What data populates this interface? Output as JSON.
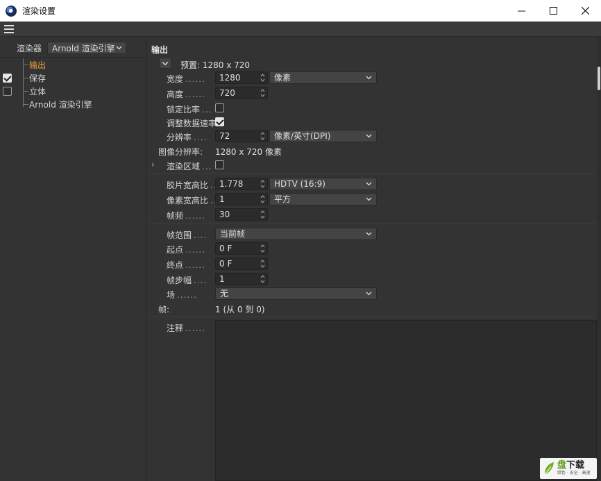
{
  "window": {
    "title": "渲染设置"
  },
  "sidebar": {
    "renderer_label": "渲染器",
    "renderer_value": "Arnold 渲染引擎",
    "items": [
      {
        "label": "输出",
        "active": true,
        "checkbox": false
      },
      {
        "label": "保存",
        "active": false,
        "checkbox": true,
        "checked": true
      },
      {
        "label": "立体",
        "active": false,
        "checkbox": true,
        "checked": false
      },
      {
        "label": "Arnold 渲染引擎",
        "active": false,
        "checkbox": false
      }
    ]
  },
  "output": {
    "section_title": "输出",
    "preset": "预置: 1280 x 720",
    "width_label": "宽度",
    "width_value": "1280",
    "height_label": "高度",
    "height_value": "720",
    "unit_value": "像素",
    "lock_ratio_label": "锁定比率",
    "lock_ratio_checked": false,
    "adjust_rate_label": "调整数据速率",
    "adjust_rate_checked": true,
    "resolution_label": "分辨率",
    "resolution_value": "72",
    "resolution_unit": "像素/英寸(DPI)",
    "image_resolution_label": "图像分辨率:",
    "image_resolution_value": "1280 x 720 像素",
    "render_region_label": "渲染区域",
    "render_region_checked": false,
    "film_aspect_label": "胶片宽高比",
    "film_aspect_value": "1.778",
    "film_aspect_preset": "HDTV (16:9)",
    "pixel_aspect_label": "像素宽高比",
    "pixel_aspect_value": "1",
    "pixel_aspect_preset": "平方",
    "fps_label": "帧频",
    "fps_value": "30",
    "frame_range_label": "帧范围",
    "frame_range_value": "当前帧",
    "start_label": "起点",
    "start_value": "0 F",
    "end_label": "终点",
    "end_value": "0 F",
    "frame_step_label": "帧步幅",
    "frame_step_value": "1",
    "field_label": "场",
    "field_value": "无",
    "frames_label": "帧:",
    "frames_value": "1 (从 0 到 0)",
    "notes_label": "注释",
    "dots6": "......",
    "dots5": ".....",
    "dots4": "....",
    "dots3": "..."
  },
  "watermark": {
    "main_a": "盘",
    "main_b": "下载",
    "sub": "绿色 · 安全 · 高速"
  },
  "colors": {
    "accent_active": "#f1a33a",
    "bg": "#333333"
  }
}
